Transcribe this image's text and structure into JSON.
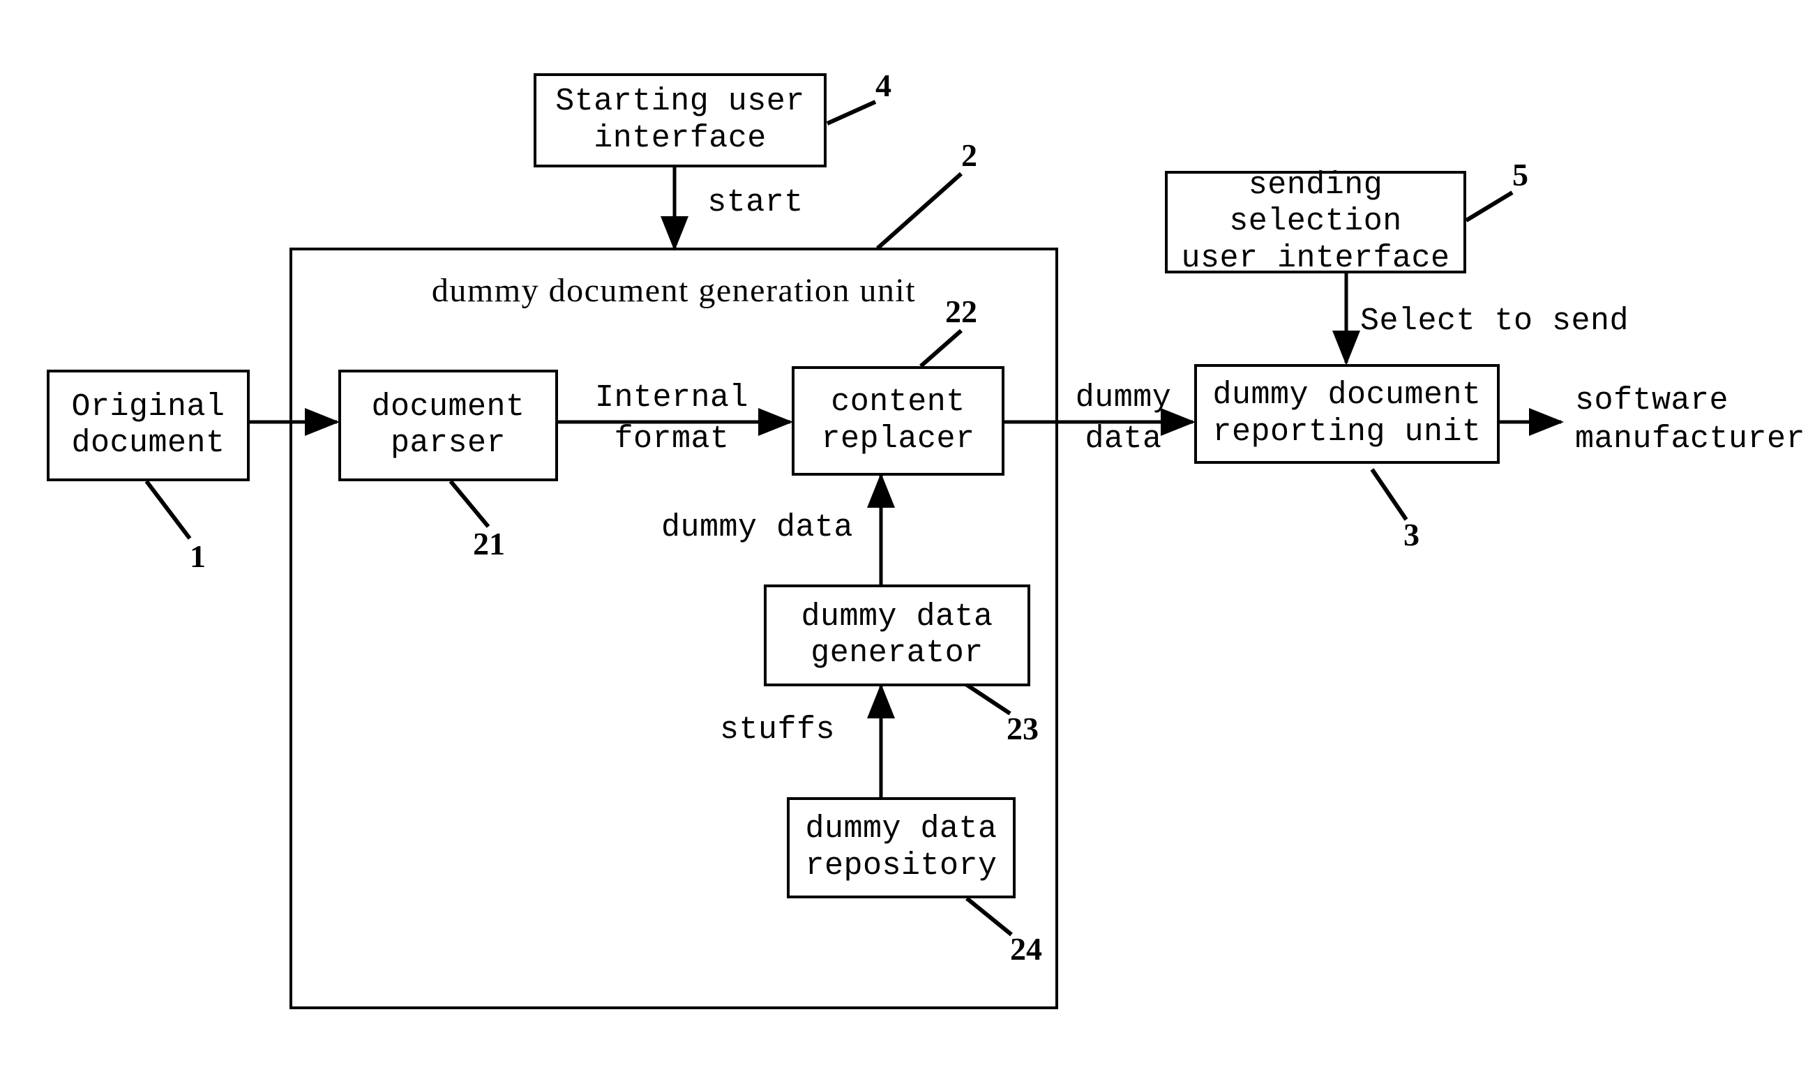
{
  "figure": {
    "kind": "patent-block-diagram",
    "background_color": "#ffffff",
    "line_color": "#000000"
  },
  "boxes": {
    "original_document": "Original\ndocument",
    "document_parser": "document\nparser",
    "content_replacer": "content\nreplacer",
    "dummy_data_generator": "dummy data\ngenerator",
    "dummy_data_repository": "dummy data\nrepository",
    "starting_user_interface": "Starting user\ninterface",
    "sending_selection_user_interface": "sending selection\nuser interface",
    "dummy_document_reporting_unit": "dummy document\nreporting unit",
    "generation_unit_title": "dummy document generation unit"
  },
  "edge_labels": {
    "start": "start",
    "internal_format": "Internal\nformat",
    "dummy_data_to_replacer": "dummy data",
    "stuffs": "stuffs",
    "dummy_data_out": "dummy\ndata",
    "select_to_send": "Select to send"
  },
  "plain_labels": {
    "software_manufacturer": "software\nmanufacturer"
  },
  "reference_numerals": {
    "original_document": "1",
    "generation_unit": "2",
    "reporting_unit": "3",
    "starting_ui": "4",
    "sending_selection_ui": "5",
    "document_parser": "21",
    "content_replacer": "22",
    "dummy_data_generator": "23",
    "dummy_data_repository": "24"
  }
}
